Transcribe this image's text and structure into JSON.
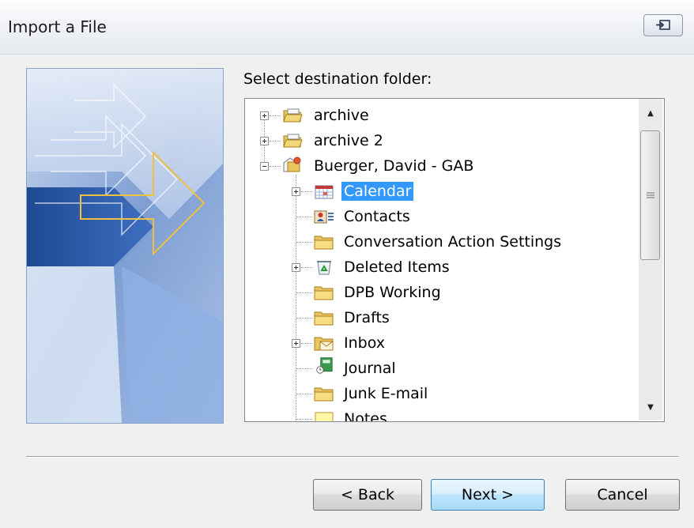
{
  "window": {
    "title": "Import a File"
  },
  "prompt": "Select destination folder:",
  "tree": [
    {
      "label": "archive",
      "icon": "pst-folder-icon",
      "level": 0,
      "expandable": true,
      "selected": false
    },
    {
      "label": "archive 2",
      "icon": "pst-folder-icon",
      "level": 0,
      "expandable": true,
      "selected": false
    },
    {
      "label": "Buerger, David - GAB",
      "icon": "mailbox-icon",
      "level": 0,
      "expanded": true,
      "selected": false
    },
    {
      "label": "Calendar",
      "icon": "calendar-icon",
      "level": 1,
      "expandable": true,
      "selected": true
    },
    {
      "label": "Contacts",
      "icon": "contacts-icon",
      "level": 1,
      "expandable": false,
      "selected": false
    },
    {
      "label": "Conversation Action Settings",
      "icon": "folder-icon",
      "level": 1,
      "expandable": false,
      "selected": false
    },
    {
      "label": "Deleted Items",
      "icon": "recycle-bin-icon",
      "level": 1,
      "expandable": true,
      "selected": false
    },
    {
      "label": "DPB Working",
      "icon": "folder-icon",
      "level": 1,
      "expandable": false,
      "selected": false
    },
    {
      "label": "Drafts",
      "icon": "folder-icon",
      "level": 1,
      "expandable": false,
      "selected": false
    },
    {
      "label": "Inbox",
      "icon": "inbox-icon",
      "level": 1,
      "expandable": true,
      "selected": false
    },
    {
      "label": "Journal",
      "icon": "journal-icon",
      "level": 1,
      "expandable": false,
      "selected": false
    },
    {
      "label": "Junk E-mail",
      "icon": "folder-icon",
      "level": 1,
      "expandable": false,
      "selected": false
    },
    {
      "label": "Notes",
      "icon": "notes-icon",
      "level": 1,
      "expandable": false,
      "selected": false
    }
  ],
  "buttons": {
    "back": "< Back",
    "next": "Next >",
    "cancel": "Cancel"
  },
  "colors": {
    "selection": "#3399ff",
    "banner_blue": "#2f5fa8",
    "arrow_yellow": "#f0c040"
  }
}
